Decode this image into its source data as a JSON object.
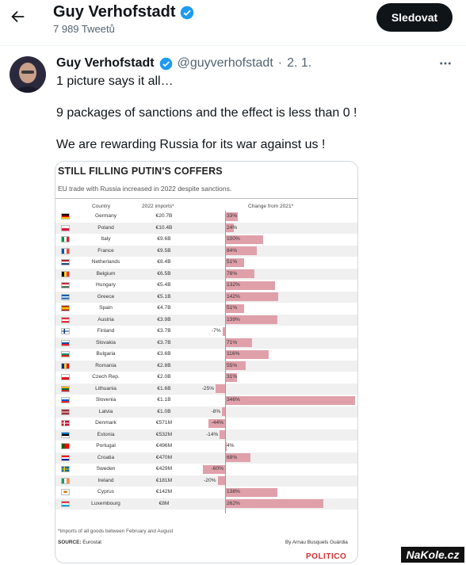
{
  "header": {
    "name": "Guy Verhofstadt",
    "tweet_count": "7 989 Tweetů",
    "follow_label": "Sledovat"
  },
  "tweet": {
    "name": "Guy Verhofstadt",
    "handle": "@guyverhofstadt",
    "separator": "·",
    "date": "2. 1.",
    "lines": [
      "1 picture says it all…",
      "9 packages of sanctions and the effect is less than 0 !",
      "We are rewarding Russia for its war against us !"
    ]
  },
  "image": {
    "title": "STILL FILLING PUTIN'S COFFERS",
    "subtitle": "EU trade with Russia increased in 2022 despite sanctions.",
    "col_country": "Country",
    "col_imports": "2022 imports*",
    "col_change": "Change from 2021*",
    "footnote": "*Imports of all goods between February and August",
    "source_label": "SOURCE:",
    "source_value": " Eurostat",
    "byline": "By Arnau Busquets Guàrdia",
    "logo": "POLITICO"
  },
  "chart_data": {
    "type": "bar",
    "title": "STILL FILLING PUTIN'S COFFERS",
    "subtitle": "EU trade with Russia increased in 2022 despite sanctions.",
    "categories": [
      "Germany",
      "Poland",
      "Italy",
      "France",
      "Netherlands",
      "Belgium",
      "Hungary",
      "Greece",
      "Spain",
      "Austria",
      "Finland",
      "Slovakia",
      "Bulgaria",
      "Romania",
      "Czech Rep.",
      "Lithuania",
      "Slovenia",
      "Latvia",
      "Denmark",
      "Estonia",
      "Portugal",
      "Croatia",
      "Sweden",
      "Ireland",
      "Cyprus",
      "Luxembourg"
    ],
    "imports_2022": [
      "€20.7B",
      "€10.4B",
      "€9.6B",
      "€9.5B",
      "€8.4B",
      "€6.5B",
      "€5.4B",
      "€5.1B",
      "€4.7B",
      "€3.9B",
      "€3.7B",
      "€3.7B",
      "€3.6B",
      "€2.8B",
      "€2.0B",
      "€1.6B",
      "€1.1B",
      "€1.0B",
      "€571M",
      "€532M",
      "€496M",
      "€470M",
      "€429M",
      "€181M",
      "€142M",
      "€8M"
    ],
    "series": [
      {
        "name": "Change from 2021*",
        "values": [
          33,
          24,
          100,
          84,
          51,
          78,
          132,
          142,
          51,
          139,
          -7,
          71,
          116,
          55,
          31,
          -25,
          346,
          -8,
          -44,
          -14,
          4,
          68,
          -60,
          -20,
          138,
          262
        ]
      }
    ],
    "value_labels": [
      "33%",
      "24%",
      "100%",
      "84%",
      "51%",
      "78%",
      "132%",
      "142%",
      "51%",
      "139%",
      "-7%",
      "71%",
      "116%",
      "55%",
      "31%",
      "-25%",
      "346%",
      "-8%",
      "-44%",
      "-14%",
      "4%",
      "68%",
      "-60%",
      "-20%",
      "138%",
      "262%"
    ]
  },
  "watermark": "NaKole.cz"
}
